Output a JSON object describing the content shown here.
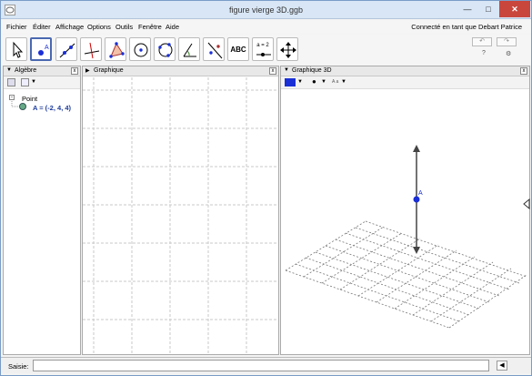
{
  "window": {
    "title": "figure vierge 3D.ggb",
    "min": "—",
    "max": "□",
    "close": "✕"
  },
  "menu": {
    "items": [
      "Fichier",
      "Éditer",
      "Affichage",
      "Options",
      "Outils",
      "Fenêtre",
      "Aide"
    ],
    "login": "Connecté en tant que Debart Patrice"
  },
  "toolbar": {
    "tools": [
      {
        "icon": "move-cursor-icon"
      },
      {
        "icon": "point-icon",
        "selected": true
      },
      {
        "icon": "line-icon"
      },
      {
        "icon": "perpendicular-icon"
      },
      {
        "icon": "polygon-icon"
      },
      {
        "icon": "circle-icon"
      },
      {
        "icon": "circle-three-points-icon"
      },
      {
        "icon": "angle-icon"
      },
      {
        "icon": "reflect-icon"
      },
      {
        "icon": "text-icon",
        "label": "ABC"
      },
      {
        "icon": "slider-icon",
        "label": "a = 2"
      },
      {
        "icon": "move-view-icon"
      }
    ],
    "undo": "↶",
    "redo": "↷",
    "help": "?",
    "settings": "⚙"
  },
  "panels": {
    "algebra": {
      "title": "Algèbre",
      "category": "Point",
      "object": "A = (-2, 4, 4)"
    },
    "graphics": {
      "title": "Graphique"
    },
    "graphics3d": {
      "title": "Graphique 3D",
      "point_label": "A"
    }
  },
  "inputbar": {
    "label": "Saisie:",
    "value": "",
    "kbd": "◀"
  },
  "colors": {
    "accent": "#1d3b9c",
    "point": "#1a2fd6",
    "selected_border": "#4a68b0"
  }
}
